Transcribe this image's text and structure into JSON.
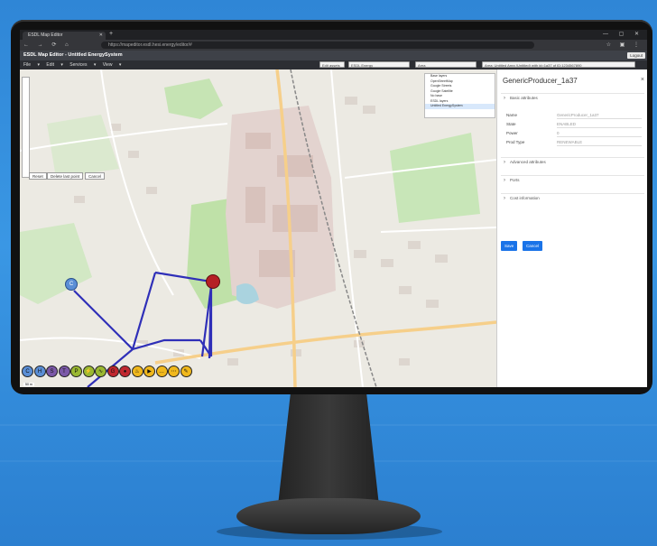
{
  "browser": {
    "tab_title": "ESDL Map Editor",
    "url": "https://mapeditor.esdl.hesi.energy/editor/#",
    "new_tab_icon": "plus-icon",
    "window_controls": "— ▢ ✕"
  },
  "app": {
    "title": "ESDL Map Editor - Untitled EnergySystem",
    "login_label": "Logout"
  },
  "menu": {
    "items": [
      "File ▾",
      "Edit ▾",
      "Services ▾",
      "View ▾"
    ],
    "edit_assets": "Edit assets",
    "esdl_layer": "ESDL Energy",
    "area": "Area",
    "energysystem": "Area: Untitled Area (Untitled) with id=1a37 of ID:1234567890"
  },
  "map": {
    "buttons": [
      "Reset",
      "Delete last point",
      "Cancel"
    ],
    "layers": [
      "Base layers",
      "OpenStreetMap",
      "Google Streets",
      "Google Satellite",
      "No base",
      "ESDL layers",
      "Untitled EnergySystem"
    ],
    "scale": "50 m"
  },
  "toolbar": {
    "tools": [
      {
        "icon": "consumer-icon",
        "glyph": "C",
        "color": "#5b8fd6"
      },
      {
        "icon": "heat-pump-icon",
        "glyph": "H",
        "color": "#5b8fd6"
      },
      {
        "icon": "storage-icon",
        "glyph": "S",
        "color": "#7b59a8"
      },
      {
        "icon": "conversion-icon",
        "glyph": "T",
        "color": "#7b59a8"
      },
      {
        "icon": "pipe-icon",
        "glyph": "P",
        "color": "#9ab832"
      },
      {
        "icon": "transport-icon",
        "glyph": "⚡",
        "color": "#9ab832"
      },
      {
        "icon": "cable-icon",
        "glyph": "∿",
        "color": "#9ab832"
      },
      {
        "icon": "producer-icon",
        "glyph": "G",
        "color": "#c0282f"
      },
      {
        "icon": "generic-producer-icon",
        "glyph": "●",
        "color": "#c0282f"
      },
      {
        "icon": "flame-icon",
        "glyph": "♨",
        "color": "#f0b81c"
      },
      {
        "icon": "play-icon",
        "glyph": "▶",
        "color": "#f0b81c"
      },
      {
        "icon": "more-icon",
        "glyph": "…",
        "color": "#f0b81c"
      },
      {
        "icon": "dots-icon",
        "glyph": "⋯",
        "color": "#f0b81c"
      },
      {
        "icon": "pencil-icon",
        "glyph": "✎",
        "color": "#f0b81c"
      }
    ]
  },
  "panel": {
    "title": "GenericProducer_1a37",
    "close": "×",
    "sections": {
      "basic": "Basic attributes",
      "advanced": "Advanced attributes",
      "ports": "Ports",
      "cost": "Cost information"
    },
    "fields": [
      {
        "label": "Name",
        "value": "GenericProducer_1a37"
      },
      {
        "label": "State",
        "value": "ENABLED"
      },
      {
        "label": "Power",
        "value": "0"
      },
      {
        "label": "Prod Type",
        "value": "RENEWABLE"
      }
    ],
    "save": "Save",
    "cancel": "Cancel"
  }
}
